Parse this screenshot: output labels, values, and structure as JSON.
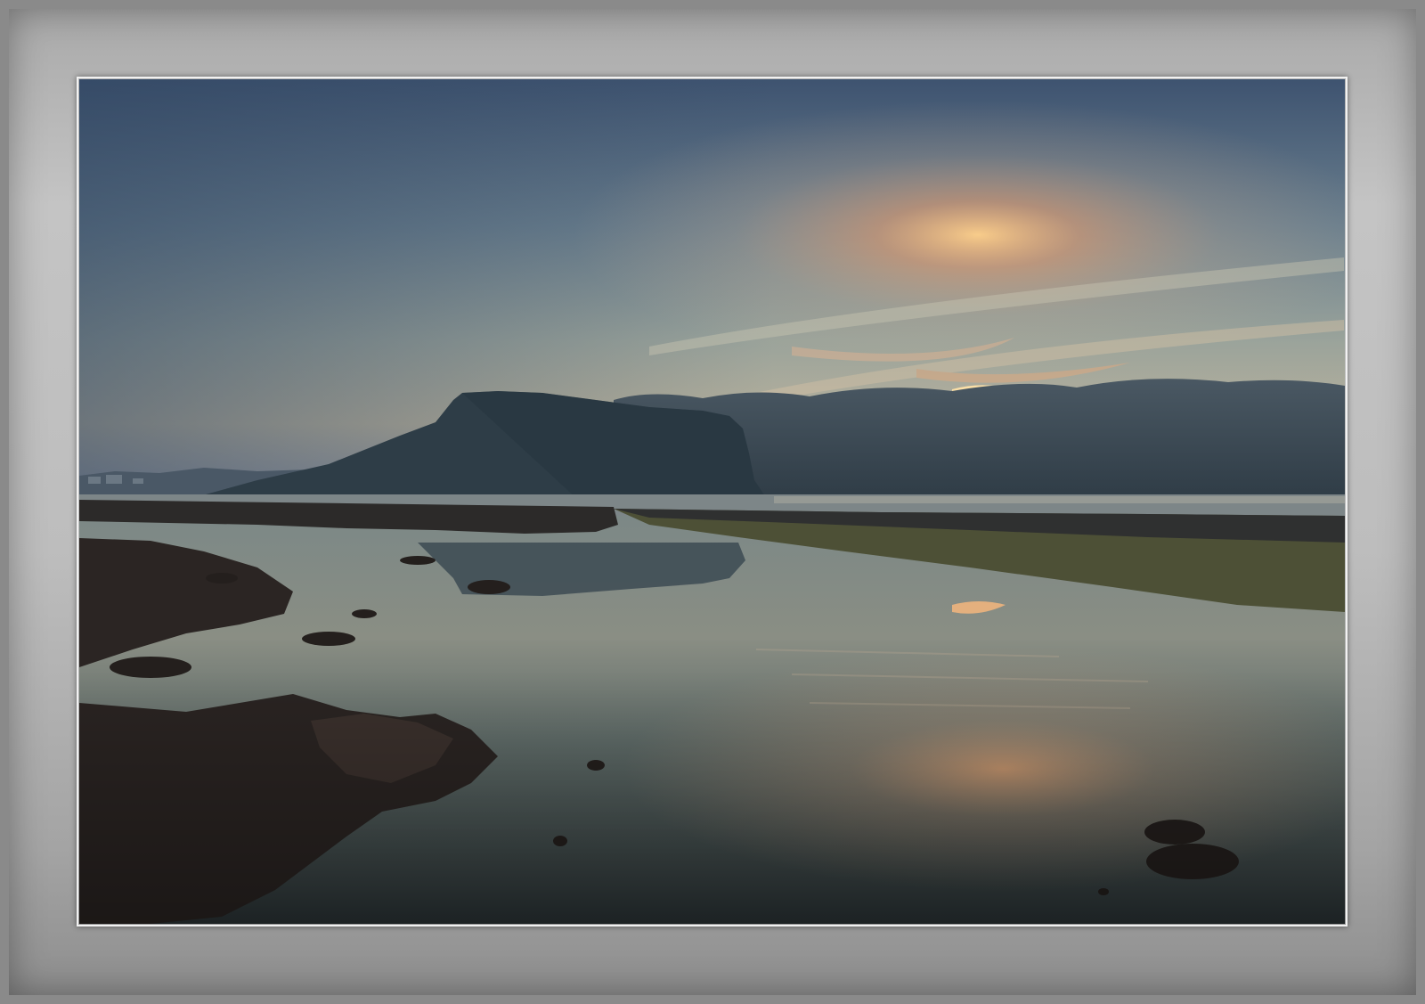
{
  "scene": {
    "colors": {
      "frame_light": "#c4c4c4",
      "frame_dark": "#8e8e8e",
      "sky_top": "#3f5570",
      "sky_mid": "#7e9099",
      "sky_horizon": "#b9b7a4",
      "sun_glow": "#f2a46a",
      "mountain": "#2f3e47",
      "cloud_bank": "#3a4a56",
      "water_dark": "#2b3437",
      "water_mid": "#6f7c78",
      "rock": "#2a2624",
      "algae": "#5f6a3c"
    }
  }
}
